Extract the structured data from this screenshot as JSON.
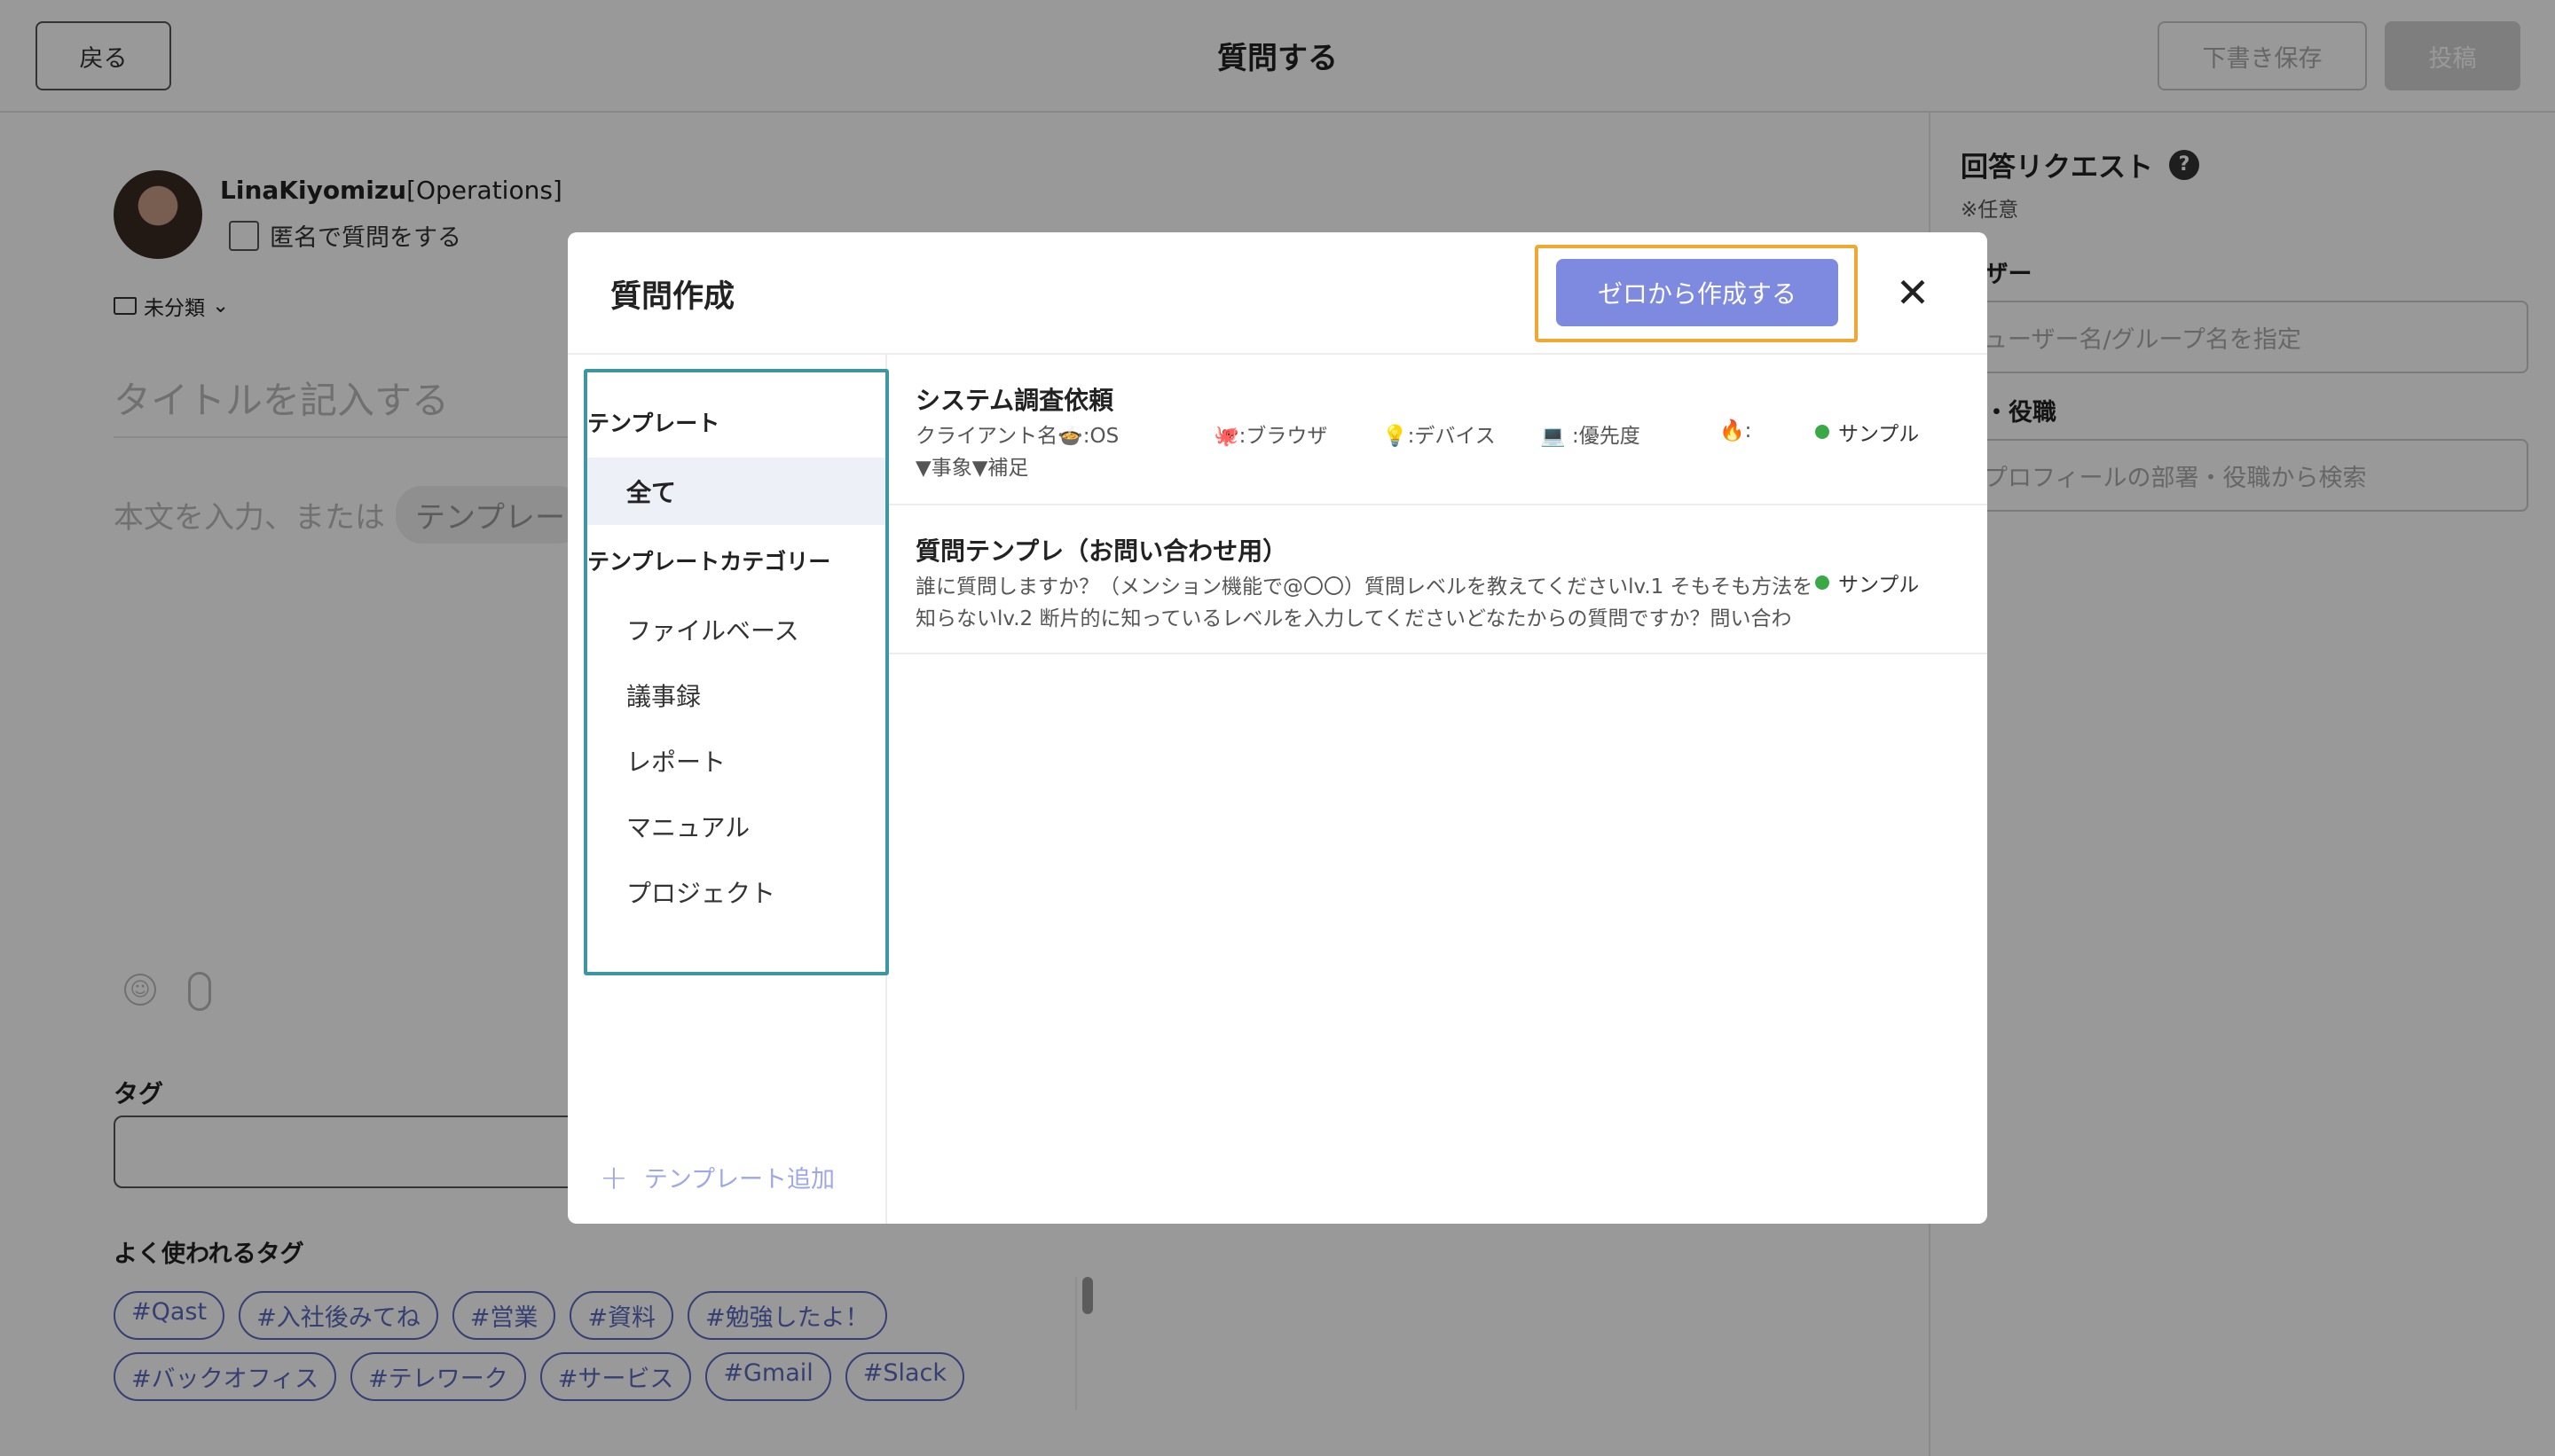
{
  "header": {
    "back_label": "戻る",
    "title": "質問する",
    "draft_label": "下書き保存",
    "post_label": "投稿"
  },
  "editor": {
    "username": "LinaKiyomizu",
    "department": "[Operations]",
    "anonymous_label": "匿名で質問をする",
    "folder_label": "未分類",
    "title_placeholder": "タイトルを記入する",
    "body_placeholder": "本文を入力、または",
    "template_pill": "テンプレー",
    "tag_label": "タグ",
    "frequent_tags_label": "よく使われるタグ",
    "frequent_tags": [
      "#Qast",
      "#入社後みてね",
      "#営業",
      "#資料",
      "#勉強したよ！",
      "#バックオフィス",
      "#テレワーク",
      "#サービス",
      "#Gmail",
      "#Slack"
    ]
  },
  "answer_request": {
    "title": "回答リクエスト",
    "help_icon": "?",
    "optional_note": "※任意",
    "user_label": "ーザー",
    "user_placeholder": "ューザー名/グループ名を指定",
    "dept_label": "署・役職",
    "dept_placeholder": "プロフィールの部署・役職から検索"
  },
  "modal": {
    "title": "質問作成",
    "create_from_scratch": "ゼロから作成する",
    "close_icon": "✕",
    "sidebar": {
      "templates_heading": "テンプレート",
      "all_label": "全て",
      "categories_heading": "テンプレートカテゴリー",
      "categories": [
        "ファイルベース",
        "議事録",
        "レポート",
        "マニュアル",
        "プロジェクト"
      ],
      "add_template_label": "テンプレート追加"
    },
    "templates": [
      {
        "name": "システム調査依頼",
        "frag_1": "クライアント名🍲:OS",
        "frag_2": "🐙:ブラウザ",
        "frag_3": "💡:デバイス",
        "frag_4": "💻 :優先度",
        "frag_5": "🔥:",
        "line_2": "▼事象▼補足",
        "badge": "サンプル"
      },
      {
        "name": "質問テンプレ（お問い合わせ用）",
        "line_1": "誰に質問しますか？（メンション機能で@〇〇）質問レベルを教えてくださいlv.1 そもそも方法を",
        "line_2": "知らないlv.2 断片的に知っているレベルを入力してくださいどなたからの質問ですか？問い合わ",
        "badge": "サンプル"
      }
    ]
  },
  "colors": {
    "accent": "#7e89e0",
    "highlight_orange": "#f0a832",
    "highlight_teal": "#3d97a3",
    "tag_blue": "#5b6abf",
    "sample_green": "#3aa945"
  }
}
